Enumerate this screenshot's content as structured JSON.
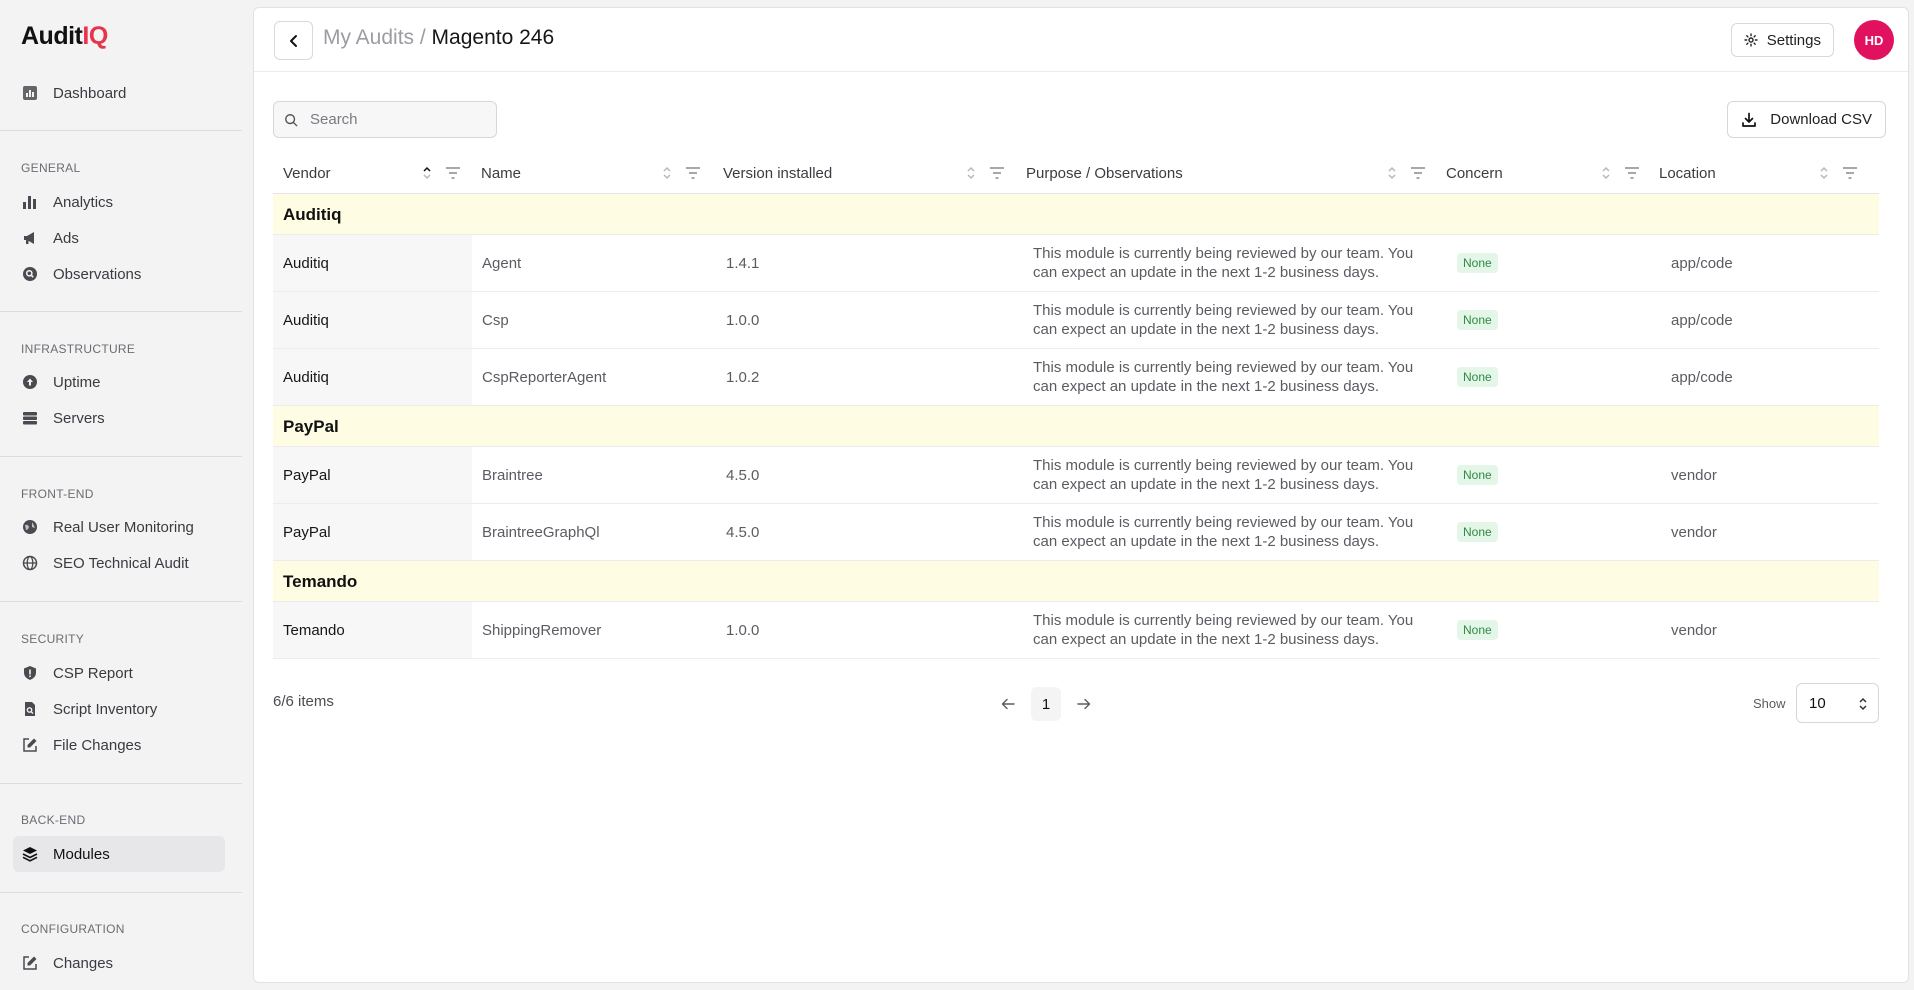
{
  "brand": {
    "name_main": "Audit",
    "name_accent": "IQ"
  },
  "sidebar": {
    "dashboard": "Dashboard",
    "sections": [
      {
        "label": "GENERAL",
        "items": [
          "Analytics",
          "Ads",
          "Observations"
        ]
      },
      {
        "label": "INFRASTRUCTURE",
        "items": [
          "Uptime",
          "Servers"
        ]
      },
      {
        "label": "FRONT-END",
        "items": [
          "Real User Monitoring",
          "SEO Technical Audit"
        ]
      },
      {
        "label": "SECURITY",
        "items": [
          "CSP Report",
          "Script Inventory",
          "File Changes"
        ]
      },
      {
        "label": "BACK-END",
        "items": [
          "Modules"
        ]
      },
      {
        "label": "CONFIGURATION",
        "items": [
          "Changes"
        ]
      }
    ],
    "active_item": "Modules"
  },
  "header": {
    "breadcrumb_parent": "My Audits /",
    "breadcrumb_current": "Magento 246",
    "settings_label": "Settings",
    "avatar_initials": "HD"
  },
  "toolbar": {
    "search_placeholder": "Search",
    "download_label": "Download CSV"
  },
  "table": {
    "columns": [
      "Vendor",
      "Name",
      "Version installed",
      "Purpose / Observations",
      "Concern",
      "Location"
    ],
    "sorted_column": "Vendor",
    "groups": [
      {
        "vendor": "Auditiq",
        "rows": [
          {
            "vendor": "Auditiq",
            "name": "Agent",
            "version": "1.4.1",
            "purpose_line1": "This module is currently being reviewed by our team. You",
            "purpose_line2": "can expect an update in the next 1-2 business days.",
            "concern": "None",
            "location": "app/code"
          },
          {
            "vendor": "Auditiq",
            "name": "Csp",
            "version": "1.0.0",
            "purpose_line1": "This module is currently being reviewed by our team. You",
            "purpose_line2": "can expect an update in the next 1-2 business days.",
            "concern": "None",
            "location": "app/code"
          },
          {
            "vendor": "Auditiq",
            "name": "CspReporterAgent",
            "version": "1.0.2",
            "purpose_line1": "This module is currently being reviewed by our team. You",
            "purpose_line2": "can expect an update in the next 1-2 business days.",
            "concern": "None",
            "location": "app/code"
          }
        ]
      },
      {
        "vendor": "PayPal",
        "rows": [
          {
            "vendor": "PayPal",
            "name": "Braintree",
            "version": "4.5.0",
            "purpose_line1": "This module is currently being reviewed by our team. You",
            "purpose_line2": "can expect an update in the next 1-2 business days.",
            "concern": "None",
            "location": "vendor"
          },
          {
            "vendor": "PayPal",
            "name": "BraintreeGraphQl",
            "version": "4.5.0",
            "purpose_line1": "This module is currently being reviewed by our team. You",
            "purpose_line2": "can expect an update in the next 1-2 business days.",
            "concern": "None",
            "location": "vendor"
          }
        ]
      },
      {
        "vendor": "Temando",
        "rows": [
          {
            "vendor": "Temando",
            "name": "ShippingRemover",
            "version": "1.0.0",
            "purpose_line1": "This module is currently being reviewed by our team. You",
            "purpose_line2": "can expect an update in the next 1-2 business days.",
            "concern": "None",
            "location": "vendor"
          }
        ]
      }
    ]
  },
  "footer": {
    "items_count": "6/6 items",
    "current_page": "1",
    "show_label": "Show",
    "page_size": "10"
  },
  "colors": {
    "brand_accent": "#e8344a",
    "avatar_bg": "#e0125f",
    "group_row_bg": "#fefde4",
    "badge_bg": "#e3f6e7",
    "badge_text": "#2f8a45"
  }
}
